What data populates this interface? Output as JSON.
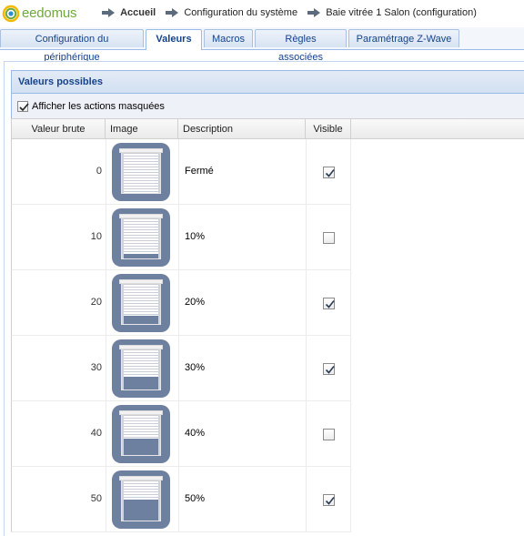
{
  "brand": {
    "name": "eedomus",
    "logo_colors": [
      "#f5b800",
      "#6fa83a",
      "#2a8fd8"
    ]
  },
  "breadcrumb": [
    {
      "label": "Accueil",
      "bold": true
    },
    {
      "label": "Configuration du système",
      "bold": false
    },
    {
      "label": "Baie vitrée 1 Salon (configuration)",
      "bold": false
    }
  ],
  "tabs": [
    {
      "label": "Configuration du périphérique",
      "active": false
    },
    {
      "label": "Valeurs",
      "active": true
    },
    {
      "label": "Macros",
      "active": false
    },
    {
      "label": "Règles associées",
      "active": false
    },
    {
      "label": "Paramétrage Z-Wave",
      "active": false
    }
  ],
  "panel": {
    "title": "Valeurs possibles",
    "show_hidden_label": "Afficher les actions masquées",
    "show_hidden_checked": true
  },
  "grid": {
    "columns": [
      "Valeur brute",
      "Image",
      "Description",
      "Visible"
    ],
    "rows": [
      {
        "raw": "0",
        "description": "Fermé",
        "visible": true,
        "image": "shutter-closed-icon",
        "open_fraction": 0.0
      },
      {
        "raw": "10",
        "description": "10%",
        "visible": false,
        "image": "shutter-10-icon",
        "open_fraction": 0.1
      },
      {
        "raw": "20",
        "description": "20%",
        "visible": true,
        "image": "shutter-20-icon",
        "open_fraction": 0.2
      },
      {
        "raw": "30",
        "description": "30%",
        "visible": true,
        "image": "shutter-30-icon",
        "open_fraction": 0.3
      },
      {
        "raw": "40",
        "description": "40%",
        "visible": false,
        "image": "shutter-40-icon",
        "open_fraction": 0.4
      },
      {
        "raw": "50",
        "description": "50%",
        "visible": true,
        "image": "shutter-50-icon",
        "open_fraction": 0.5
      }
    ]
  },
  "colors": {
    "accent": "#15428b",
    "icon_bg": "#6e809f",
    "header_border": "#99bbe8"
  }
}
